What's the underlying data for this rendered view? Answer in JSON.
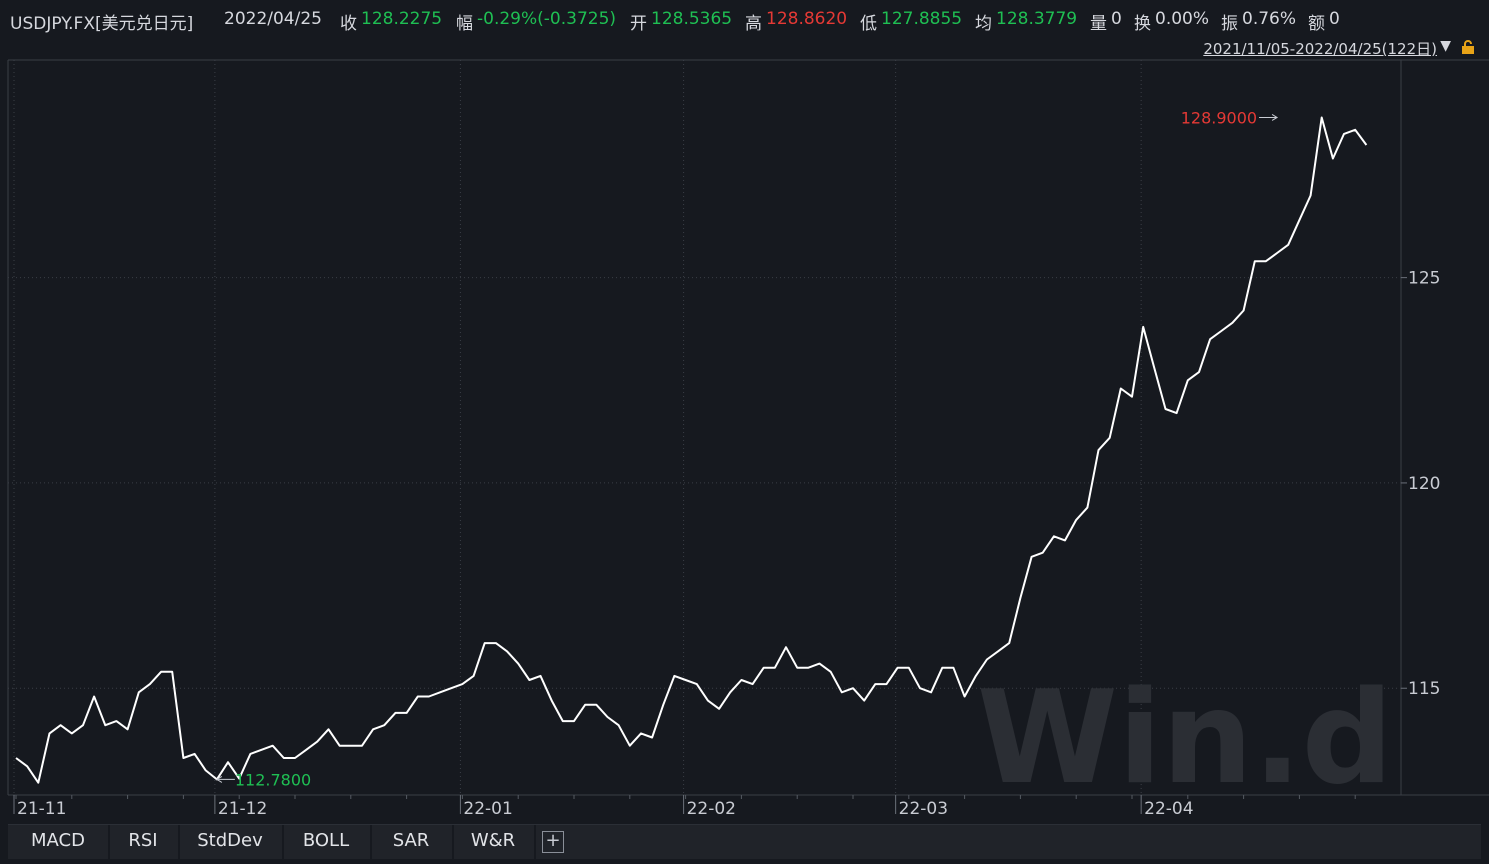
{
  "header": {
    "symbol": "USDJPY.FX[美元兑日元]",
    "date": "2022/04/25",
    "close_label": "收",
    "close_value": "128.2275",
    "change_label": "幅",
    "change_value": "-0.29%(-0.3725)",
    "open_label": "开",
    "open_value": "128.5365",
    "high_label": "高",
    "high_value": "128.8620",
    "low_label": "低",
    "low_value": "127.8855",
    "avg_label": "均",
    "avg_value": "128.3779",
    "volume_label": "量",
    "volume_value": "0",
    "turnover_label": "换",
    "turnover_value": "0.00%",
    "amplitude_label": "振",
    "amplitude_value": "0.76%",
    "amount_label": "额",
    "amount_value": "0"
  },
  "range": {
    "label": "2021/11/05-2022/04/25(122日)"
  },
  "watermark": "Win.d",
  "colors": {
    "background": "#16191f",
    "line": "#ffffff",
    "up": "#e53935",
    "down": "#1fbf53",
    "grid": "#3a3e46"
  },
  "toolbar": {
    "tabs": [
      "MACD",
      "RSI",
      "StdDev",
      "BOLL",
      "SAR",
      "W&R"
    ],
    "add_icon": "plus-icon"
  },
  "chart_data": {
    "type": "line",
    "title": "",
    "xlabel": "",
    "ylabel": "",
    "ylim": [
      112.4,
      130.3
    ],
    "y_ticks": [
      115,
      120,
      125
    ],
    "x_ticks": [
      {
        "label": "21-11",
        "index": 0
      },
      {
        "label": "21-12",
        "index": 18
      },
      {
        "label": "22-01",
        "index": 40
      },
      {
        "label": "22-02",
        "index": 60
      },
      {
        "label": "22-03",
        "index": 79
      },
      {
        "label": "22-04",
        "index": 101
      }
    ],
    "grid": true,
    "annotations": [
      {
        "text": "128.9000",
        "index": 113,
        "value": 128.9,
        "color": "red"
      },
      {
        "text": "112.7800",
        "index": 18,
        "value": 112.78,
        "color": "green"
      }
    ],
    "series": [
      {
        "values": [
          113.3,
          113.1,
          112.7,
          113.9,
          114.1,
          113.9,
          114.1,
          114.8,
          114.1,
          114.2,
          114.0,
          114.9,
          115.1,
          115.4,
          115.4,
          113.3,
          113.4,
          113.0,
          112.78,
          113.2,
          112.8,
          113.4,
          113.5,
          113.6,
          113.3,
          113.3,
          113.5,
          113.7,
          114.0,
          113.6,
          113.6,
          113.6,
          114.0,
          114.1,
          114.4,
          114.4,
          114.8,
          114.8,
          114.9,
          115.0,
          115.1,
          115.3,
          116.1,
          116.1,
          115.9,
          115.6,
          115.2,
          115.3,
          114.7,
          114.2,
          114.2,
          114.6,
          114.6,
          114.3,
          114.1,
          113.6,
          113.9,
          113.8,
          114.6,
          115.3,
          115.2,
          115.1,
          114.7,
          114.5,
          114.9,
          115.2,
          115.1,
          115.5,
          115.5,
          116.0,
          115.5,
          115.5,
          115.6,
          115.4,
          114.9,
          115.0,
          114.7,
          115.1,
          115.1,
          115.5,
          115.5,
          115.0,
          114.9,
          115.5,
          115.5,
          114.8,
          115.3,
          115.7,
          115.9,
          116.1,
          117.2,
          118.2,
          118.3,
          118.7,
          118.6,
          119.1,
          119.4,
          120.8,
          121.1,
          122.3,
          122.1,
          123.8,
          122.8,
          121.8,
          121.7,
          122.5,
          122.7,
          123.5,
          123.7,
          123.9,
          124.2,
          125.4,
          125.4,
          125.6,
          125.8,
          126.4,
          127.0,
          128.9,
          127.9,
          128.5,
          128.6,
          128.23
        ]
      }
    ]
  }
}
